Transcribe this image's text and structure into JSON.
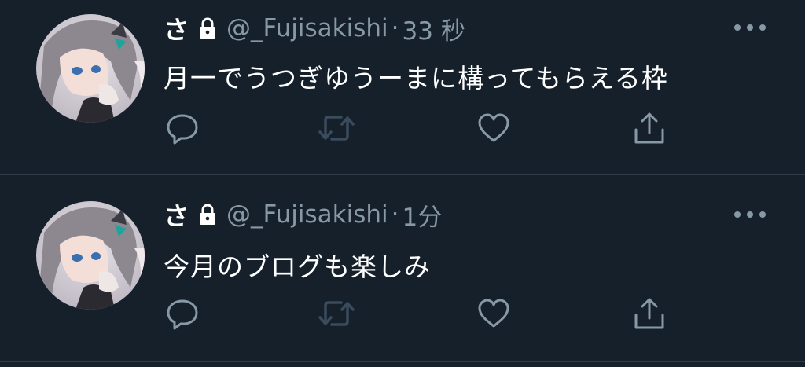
{
  "colors": {
    "background": "#15202b",
    "divider": "#2f3b47",
    "secondary_text": "#8899a6",
    "primary_text": "#ffffff",
    "retweet_disabled": "#3a4b5c"
  },
  "tweets": [
    {
      "display_name": "さ",
      "lock_icon": "lock-icon",
      "handle": "@_Fujisakishi",
      "separator": "·",
      "time": "33 秒",
      "text": "月一でうつぎゆうーまに構ってもらえる枠"
    },
    {
      "display_name": "さ",
      "lock_icon": "lock-icon",
      "handle": "@_Fujisakishi",
      "separator": "·",
      "time": "1分",
      "text": "今月のブログも楽しみ"
    }
  ],
  "actions": [
    "reply-icon",
    "retweet-icon",
    "like-icon",
    "share-icon"
  ]
}
